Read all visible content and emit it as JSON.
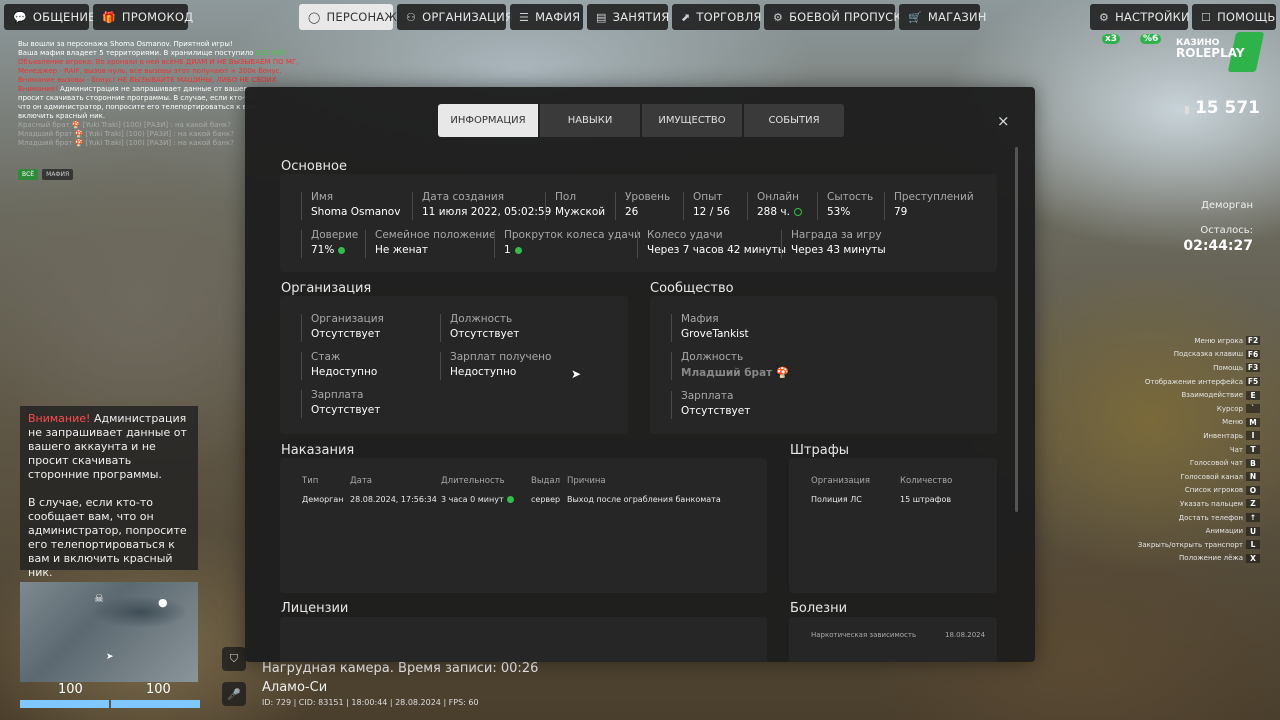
{
  "topbar": {
    "left": [
      {
        "label": "ОБЩЕНИЕ",
        "icon": "💬"
      },
      {
        "label": "ПРОМОКОД",
        "icon": "🎁"
      }
    ],
    "center": [
      {
        "label": "ПЕРСОНАЖ",
        "icon": "◯",
        "active": true
      },
      {
        "label": "ОРГАНИЗАЦИЯ",
        "icon": "⚇"
      },
      {
        "label": "МАФИЯ",
        "icon": "☰"
      },
      {
        "label": "ЗАНЯТИЯ",
        "icon": "▤"
      },
      {
        "label": "ТОРГОВЛЯ",
        "icon": "⬈"
      },
      {
        "label": "БОЕВОЙ ПРОПУСК",
        "icon": "⚙"
      },
      {
        "label": "МАГАЗИН",
        "icon": "🛒"
      }
    ],
    "right": [
      {
        "label": "НАСТРОЙКИ",
        "icon": "⚙"
      },
      {
        "label": "ПОМОЩЬ",
        "icon": "☐"
      }
    ]
  },
  "chat": {
    "line1": "Вы вошли за персонажа Shoma Osmanov. Приятной игры!",
    "line2a": "Ваша мафия владеет 5 территориями. В хранилище поступило ",
    "line2b": "$12 600",
    "line3": "Объявление игрока: Во хронахи в ней всёНЕ ДИАМ И НЕ ВЫЗЫВАЕМ ПО МГ,",
    "line4": "Менеджер - RAIF, вызов нуль, все вызовы этот получают + 200к бонус.",
    "line5": "Внимание вызовы - бонус! НЕ ВЫЗЫВАЙТЕ МАШИНЫ, ЛИБО НЕ СВОИХ",
    "line6a": "Внимание! ",
    "line6b": "Администрация не запрашивает данные от вашего",
    "line7": "просит скачивать сторонние программы. В случае, если кто-то",
    "line8": "что он администратор, попросите его телепортироваться к вам",
    "line9": "включить красный ник.",
    "line10": "Красный брат 🍄 [Yuki Traki] (100) [РА3И] : на какой банк?",
    "line11": "Младший брат 🍄 [Yuki Traki] (100) [РА3И] : на какой банк?",
    "line12": "Младший брат 🍄 [Yuki Traki] (100) [РА3И] : на какой банк?",
    "tabs": [
      "ВСЁ",
      "МАФИЯ"
    ]
  },
  "warning": {
    "prefix": "Внимание!",
    "text1": " Администрация не запрашивает данные от вашего аккаунта и не просит скачивать сторонние программы.",
    "text2": "В случае, если кто-то сообщает вам, что он администратор, попросите его телепортироваться к вам и включить красный ник."
  },
  "hud": {
    "health": "100",
    "armor": "100",
    "camera": "Нагрудная камера. Время записи: 00:26",
    "location": "Аламо-Си",
    "id_line": "ID: 729 | CID: 83151 | 18:00:44 | 28.08.2024 | FPS: 60",
    "logo_top": "КАЗИНО",
    "logo_bottom": "ROLEPLAY",
    "badge_x3": "x3",
    "badge_pct": "%6",
    "money": "15 571",
    "zone": "Деморган",
    "remaining_label": "Осталось:",
    "remaining": "02:44:27"
  },
  "hotkeys": [
    {
      "label": "Меню игрока",
      "key": "F2"
    },
    {
      "label": "Подсказка клавиш",
      "key": "F6"
    },
    {
      "label": "Помощь",
      "key": "F3"
    },
    {
      "label": "Отображение интерфейса",
      "key": "F5"
    },
    {
      "label": "Взаимодействие",
      "key": "E"
    },
    {
      "label": "Курсор",
      "key": "`"
    },
    {
      "label": "Меню",
      "key": "M"
    },
    {
      "label": "Инвентарь",
      "key": "I"
    },
    {
      "label": "Чат",
      "key": "T"
    },
    {
      "label": "Голосовой чат",
      "key": "B"
    },
    {
      "label": "Голосовой канал",
      "key": "N"
    },
    {
      "label": "Список игроков",
      "key": "O"
    },
    {
      "label": "Указать пальцем",
      "key": "Z"
    },
    {
      "label": "Достать телефон",
      "key": "↑"
    },
    {
      "label": "Анимации",
      "key": "U"
    },
    {
      "label": "Закрыть/открыть транспорт",
      "key": "L"
    },
    {
      "label": "Положение лёжа",
      "key": "X"
    }
  ],
  "panel": {
    "tabs": [
      "ИНФОРМАЦИЯ",
      "НАВЫКИ",
      "ИМУЩЕСТВО",
      "СОБЫТИЯ"
    ],
    "close": "×",
    "basic": {
      "title": "Основное",
      "name_l": "Имя",
      "name_v": "Shoma Osmanov",
      "created_l": "Дата создания",
      "created_v": "11 июля 2022, 05:02:59",
      "sex_l": "Пол",
      "sex_v": "Мужской",
      "level_l": "Уровень",
      "level_v": "26",
      "exp_l": "Опыт",
      "exp_v": "12 / 56",
      "online_l": "Онлайн",
      "online_v": "288 ч.",
      "satiety_l": "Сытость",
      "satiety_v": "53%",
      "crimes_l": "Преступлений",
      "crimes_v": "79",
      "trust_l": "Доверие",
      "trust_v": "71%",
      "family_l": "Семейное положение",
      "family_v": "Не женат",
      "spins_l": "Прокруток колеса удачи",
      "spins_v": "1",
      "wheel_l": "Колесо удачи",
      "wheel_v": "Через 7 часов 42 минуты",
      "reward_l": "Награда за игру",
      "reward_v": "Через 43 минуты"
    },
    "org": {
      "title": "Организация",
      "org_l": "Организация",
      "org_v": "Отсутствует",
      "post_l": "Должность",
      "post_v": "Отсутствует",
      "exp_l": "Стаж",
      "exp_v": "Недоступно",
      "paid_l": "Зарплат получено",
      "paid_v": "Недоступно",
      "salary_l": "Зарплата",
      "salary_v": "Отсутствует"
    },
    "community": {
      "title": "Сообщество",
      "mafia_l": "Мафия",
      "mafia_v": "GroveTankist",
      "post_l": "Должность",
      "post_v": "Младший брат",
      "salary_l": "Зарплата",
      "salary_v": "Отсутствует"
    },
    "punish": {
      "title": "Наказания",
      "headers": [
        "Тип",
        "Дата",
        "Длительность",
        "Выдал",
        "Причина"
      ],
      "row": [
        "Деморган",
        "28.08.2024, 17:56:34",
        "3 часа 0 минут",
        "сервер",
        "Выход после ограбления банкомата"
      ]
    },
    "fines": {
      "title": "Штрафы",
      "headers": [
        "Организация",
        "Количество"
      ],
      "row": [
        "Полиция ЛС",
        "15 штрафов"
      ]
    },
    "licenses": {
      "title": "Лицензии"
    },
    "diseases": {
      "title": "Болезни",
      "row": [
        "Наркотическая зависимость",
        "18.08.2024"
      ]
    }
  }
}
